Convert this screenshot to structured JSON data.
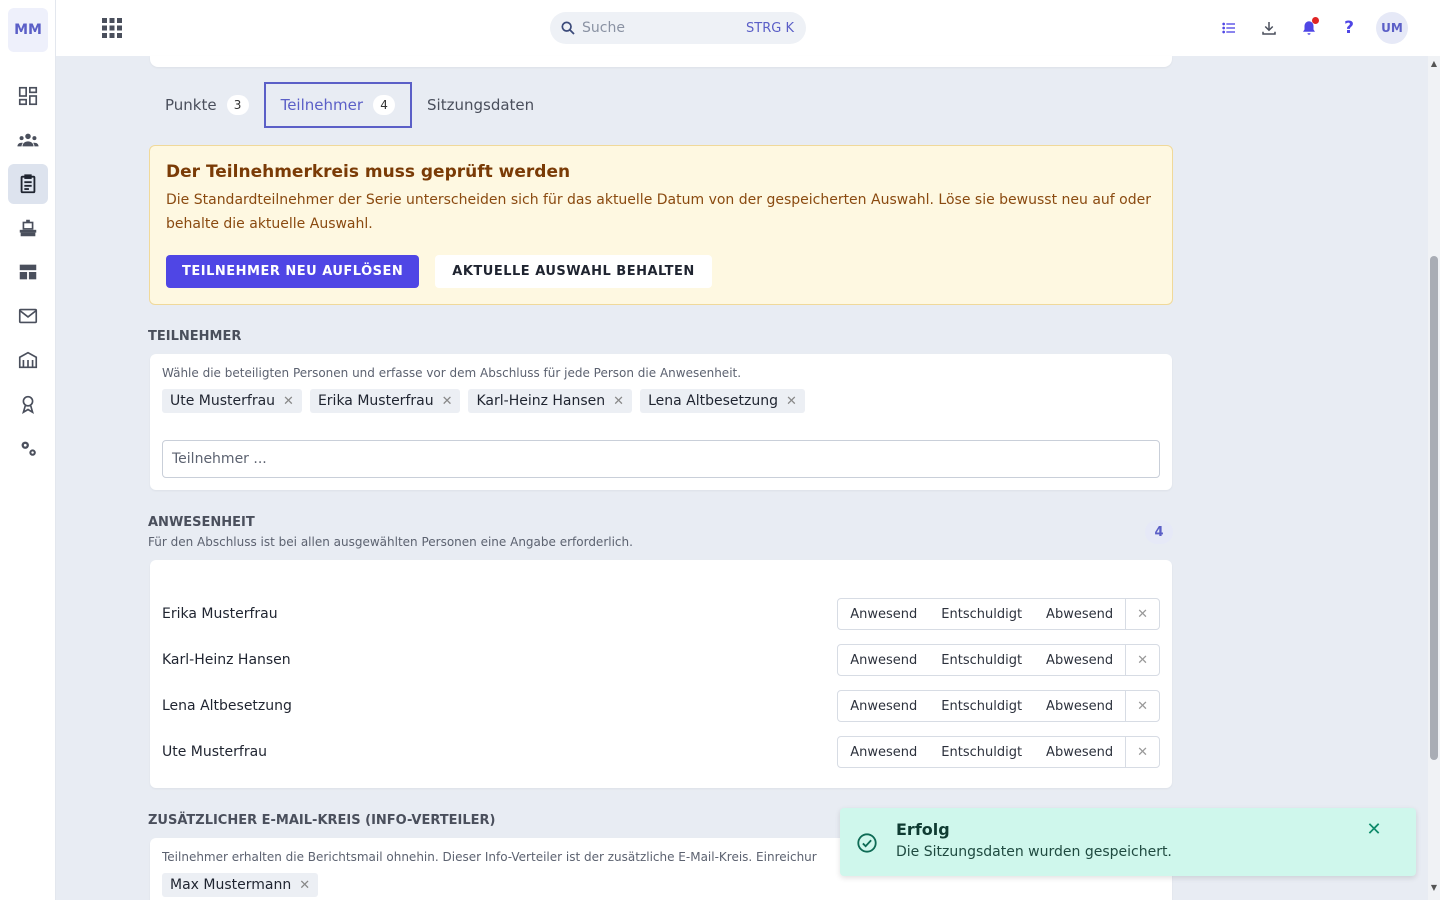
{
  "app": {
    "logo": "MM"
  },
  "topbar": {
    "search_placeholder": "Suche",
    "search_shortcut": "STRG K",
    "avatar": "UM",
    "help": "?"
  },
  "tabs": [
    {
      "label": "Punkte",
      "count": "3"
    },
    {
      "label": "Teilnehmer",
      "count": "4"
    },
    {
      "label": "Sitzungsdaten"
    }
  ],
  "warning": {
    "title": "Der Teilnehmerkreis muss geprüft werden",
    "text": "Die Standardteilnehmer der Serie unterscheiden sich für das aktuelle Datum von der gespeicherten Auswahl. Löse sie bewusst neu auf oder behalte die aktuelle Auswahl.",
    "primary_label": "TEILNEHMER NEU AUFLÖSEN",
    "secondary_label": "AKTUELLE AUSWAHL BEHALTEN"
  },
  "participants": {
    "heading": "TEILNEHMER",
    "hint": "Wähle die beteiligten Personen und erfasse vor dem Abschluss für jede Person die Anwesenheit.",
    "chips": [
      "Ute Musterfrau",
      "Erika Musterfrau",
      "Karl-Heinz Hansen",
      "Lena Altbesetzung"
    ],
    "input_placeholder": "Teilnehmer ..."
  },
  "attendance": {
    "heading": "ANWESENHEIT",
    "subtitle": "Für den Abschluss ist bei allen ausgewählten Personen eine Angabe erforderlich.",
    "count": "4",
    "options": [
      "Anwesend",
      "Entschuldigt",
      "Abwesend"
    ],
    "rows": [
      "Erika Musterfrau",
      "Karl-Heinz Hansen",
      "Lena Altbesetzung",
      "Ute Musterfrau"
    ]
  },
  "email_circle": {
    "heading": "ZUSÄTZLICHER E-MAIL-KREIS (INFO-VERTEILER)",
    "hint": "Teilnehmer erhalten die Berichtsmail ohnehin. Dieser Info-Verteiler ist der zusätzliche E-Mail-Kreis. Einreichur",
    "chips": [
      "Max Mustermann"
    ]
  },
  "toast": {
    "title": "Erfolg",
    "text": "Die Sitzungsdaten wurden gespeichert.",
    "close": "✕"
  },
  "colors": {
    "accent": "#5b5fc7",
    "primary_button": "#4f46e5",
    "warning_bg": "#fef8e1",
    "toast_bg": "#cff7ec"
  }
}
